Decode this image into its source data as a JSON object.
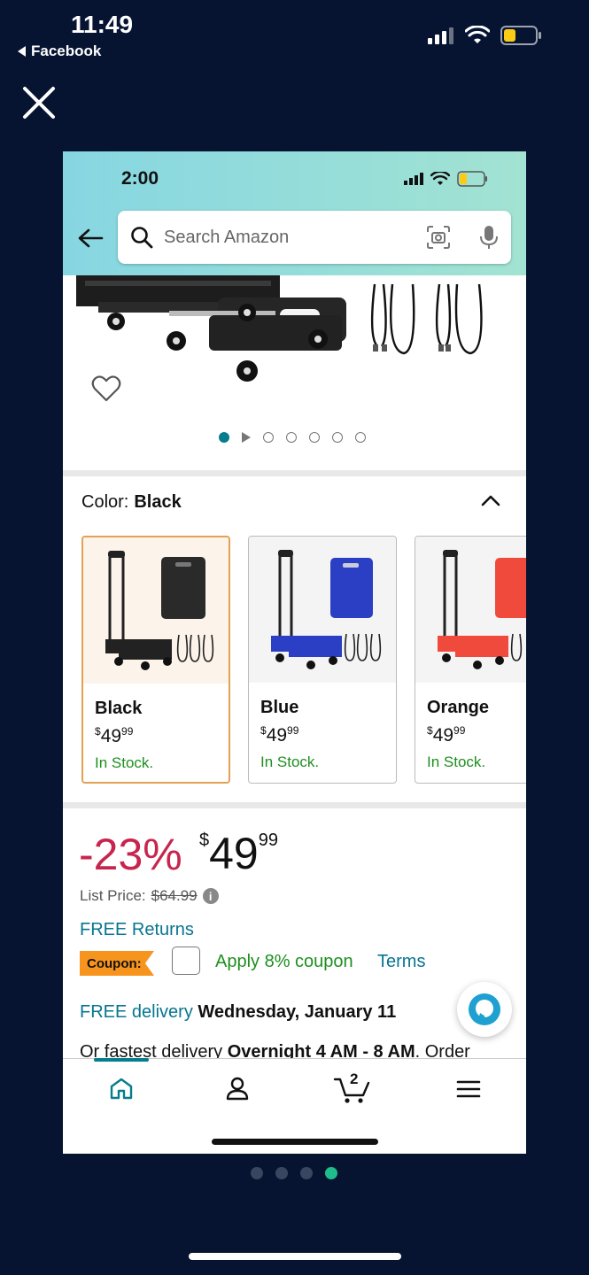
{
  "status_bar": {
    "time": "11:49",
    "back_app": "Facebook"
  },
  "embedded": {
    "status_time": "2:00",
    "search": {
      "placeholder": "Search Amazon"
    },
    "product": {
      "image_dots": 6,
      "color_label": "Color:",
      "color_value": "Black",
      "swatches": [
        {
          "name": "Black",
          "price_currency": "$",
          "price_dollars": "49",
          "price_cents": "99",
          "stock": "In Stock.",
          "color": "#2a2a2a"
        },
        {
          "name": "Blue",
          "price_currency": "$",
          "price_dollars": "49",
          "price_cents": "99",
          "stock": "In Stock.",
          "color": "#2b3fc4"
        },
        {
          "name": "Orange",
          "price_currency": "$",
          "price_dollars": "49",
          "price_cents": "99",
          "stock": "In Stock.",
          "color": "#ef4a3c"
        }
      ],
      "discount": "-23%",
      "price": {
        "currency": "$",
        "dollars": "49",
        "cents": "99"
      },
      "list_price_label": "List Price:",
      "list_price_value": "$64.99",
      "free_returns": "FREE Returns",
      "coupon_badge": "Coupon:",
      "apply_coupon": "Apply 8% coupon",
      "terms": "Terms",
      "delivery_prefix": "FREE delivery",
      "delivery_date": "Wednesday, January 11",
      "fastest_prefix": "Or fastest delivery",
      "fastest_time": "Overnight 4 AM - 8 AM",
      "fastest_suffix": ". Order"
    },
    "tabbar": {
      "cart_count": "2"
    }
  },
  "pager": {
    "total": 4,
    "active_index": 3
  },
  "colors": {
    "accent_teal": "#067d8c",
    "price_red": "#c7254e",
    "stock_green": "#1e8f1e",
    "link": "#077590",
    "coupon_orange": "#f7941d",
    "outer_bg": "#061432"
  }
}
